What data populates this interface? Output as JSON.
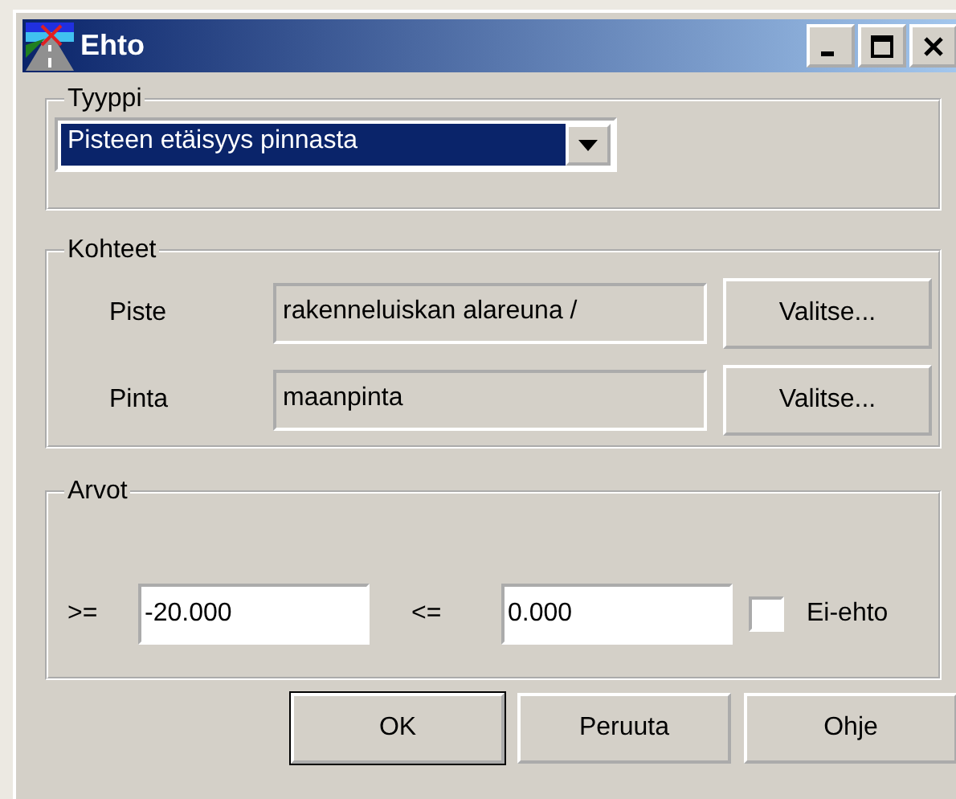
{
  "window": {
    "title": "Ehto"
  },
  "type_group": {
    "legend": "Tyyppi",
    "dropdown": {
      "value": "Pisteen etäisyys pinnasta",
      "selected": true
    }
  },
  "targets_group": {
    "legend": "Kohteet",
    "rows": [
      {
        "label": "Piste",
        "value": "rakenneluiskan alareuna /",
        "button": "Valitse..."
      },
      {
        "label": "Pinta",
        "value": "maanpinta",
        "button": "Valitse..."
      }
    ]
  },
  "values_group": {
    "legend": "Arvot",
    "min_label": ">=",
    "min_value": "-20.000",
    "max_label": "<=",
    "max_value": "0.000",
    "negate": {
      "label": "Ei-ehto",
      "checked": false
    }
  },
  "buttons": [
    {
      "label": "OK",
      "default": true
    },
    {
      "label": "Peruuta",
      "default": false
    },
    {
      "label": "Ohje",
      "default": false
    }
  ]
}
